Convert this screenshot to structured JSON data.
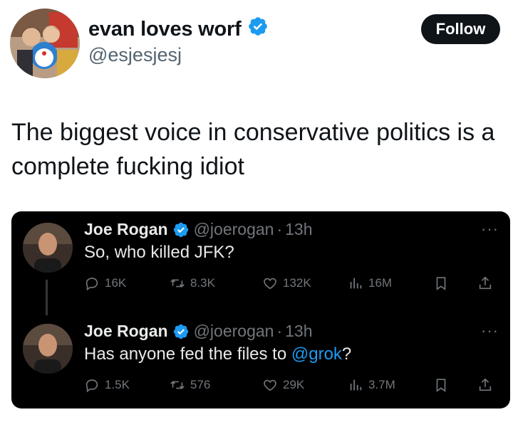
{
  "author": {
    "display_name": "evan loves worf",
    "handle": "@esjesjesj",
    "verified": true
  },
  "follow_label": "Follow",
  "tweet_text": "The biggest voice in conservative politics is a complete fucking idiot",
  "quoted_tweets": [
    {
      "name": "Joe Rogan",
      "handle": "@joerogan",
      "separator": "·",
      "time": "13h",
      "text": "So, who killed JFK?",
      "replies": "16K",
      "retweets": "8.3K",
      "likes": "132K",
      "views": "16M"
    },
    {
      "name": "Joe Rogan",
      "handle": "@joerogan",
      "separator": "·",
      "time": "13h",
      "text_before": "Has anyone fed the files to ",
      "mention": "@grok",
      "text_after": "?",
      "replies": "1.5K",
      "retweets": "576",
      "likes": "29K",
      "views": "3.7M"
    }
  ],
  "colors": {
    "verified_badge": "#1d9bf0",
    "mention": "#1d9bf0",
    "embed_background": "#000000",
    "follow_button": "#0f1419"
  }
}
